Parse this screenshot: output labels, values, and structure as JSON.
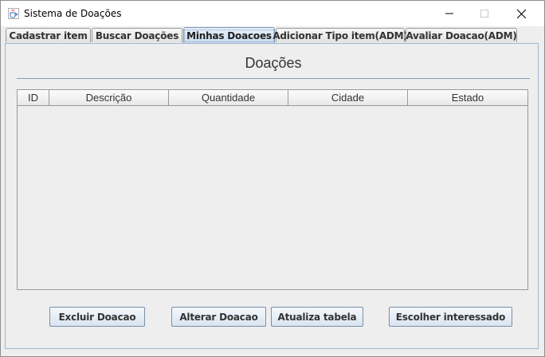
{
  "window": {
    "title": "Sistema de Doações",
    "icons": {
      "app": "java-cup-icon",
      "minimize": "minimize-icon",
      "maximize": "maximize-icon",
      "close": "close-icon"
    }
  },
  "tabs": [
    {
      "label": "Cadastrar item"
    },
    {
      "label": "Buscar Doações"
    },
    {
      "label": "Minhas Doacoes",
      "active": true
    },
    {
      "label": "Adicionar Tipo item(ADM)"
    },
    {
      "label": "Avaliar Doacao(ADM)"
    }
  ],
  "panel": {
    "heading": "Doações",
    "table": {
      "columns": [
        "ID",
        "Descrição",
        "Quantidade",
        "Cidade",
        "Estado"
      ],
      "rows": []
    },
    "buttons": {
      "delete": "Excluir Doacao",
      "edit": "Alterar Doacao",
      "refresh": "Atualiza tabela",
      "choose": "Escolher interessado"
    }
  },
  "colors": {
    "active_tab": "#c9dbee",
    "panel_border": "#9fb6d2",
    "background": "#eeeeee"
  }
}
